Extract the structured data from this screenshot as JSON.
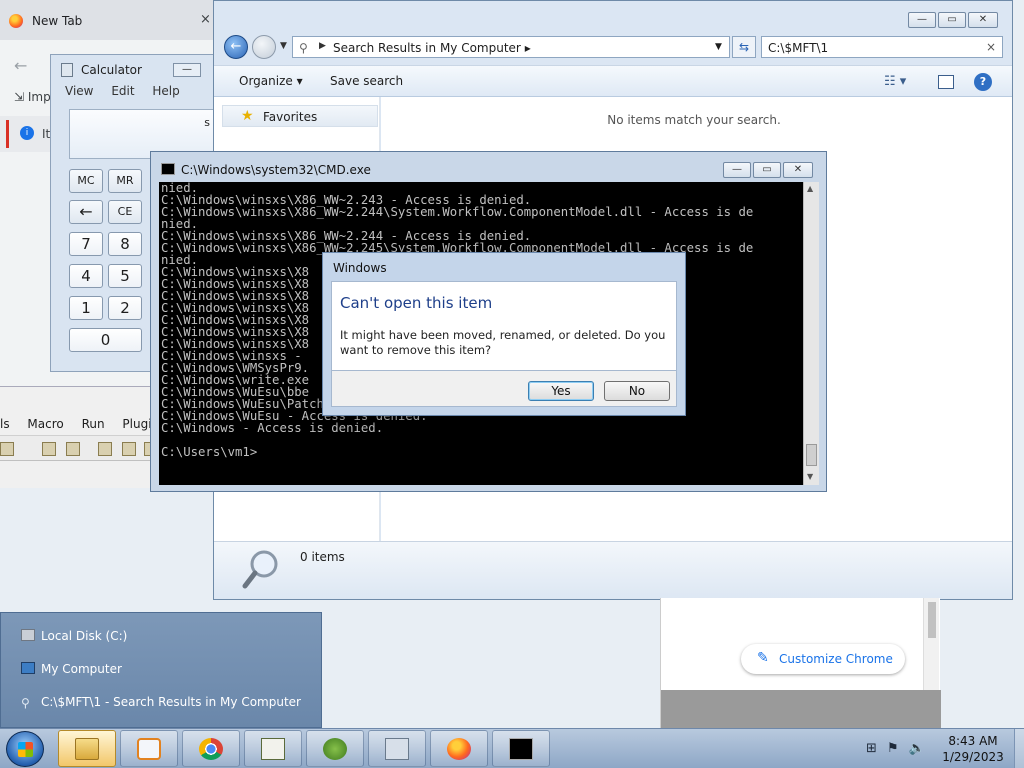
{
  "browser": {
    "tab_title": "New Tab",
    "tab_close": "×",
    "back_glyph": "←",
    "import_label": "Imp",
    "info_label": "It"
  },
  "calculator": {
    "title": "Calculator",
    "minimize_glyph": "—",
    "menu": [
      "View",
      "Edit",
      "Help"
    ],
    "display_text": "s",
    "memory_buttons": [
      "MC",
      "MR"
    ],
    "edit_buttons": [
      "←",
      "CE"
    ],
    "digits_row1": [
      "7",
      "8"
    ],
    "digits_row2": [
      "4",
      "5"
    ],
    "digits_row3": [
      "1",
      "2"
    ],
    "zero": "0"
  },
  "editor": {
    "menu": [
      "ls",
      "Macro",
      "Run",
      "Plugins"
    ]
  },
  "explorer": {
    "address_path": "Search Results in My Computer",
    "search_value": "C:\\$MFT\\1",
    "clear_glyph": "×",
    "commands": {
      "organize": "Organize ▾",
      "save_search": "Save search",
      "views": "☷ ▾",
      "help": "?"
    },
    "nav_favorites": "Favorites",
    "empty_message": "No items match your search.",
    "status_count": "0 items",
    "caption": {
      "minimize": "—",
      "maximize": "▭",
      "close": "✕"
    }
  },
  "cmd": {
    "title": "C:\\Windows\\system32\\CMD.exe",
    "caption": {
      "minimize": "—",
      "maximize": "▭",
      "close": "✕"
    },
    "lines": [
      "nied.",
      "C:\\Windows\\winsxs\\X86_WW~2.243 - Access is denied.",
      "C:\\Windows\\winsxs\\X86_WW~2.244\\System.Workflow.ComponentModel.dll - Access is de",
      "nied.",
      "C:\\Windows\\winsxs\\X86_WW~2.244 - Access is denied.",
      "C:\\Windows\\winsxs\\X86_WW~2.245\\System.Workflow.ComponentModel.dll - Access is de",
      "nied.",
      "C:\\Windows\\winsxs\\X8                                      s is denied.",
      "C:\\Windows\\winsxs\\X8",
      "C:\\Windows\\winsxs\\X8                                      s is denied.",
      "C:\\Windows\\winsxs\\X8",
      "C:\\Windows\\winsxs\\X8                                      s is denied.",
      "C:\\Windows\\winsxs\\X8",
      "C:\\Windows\\winsxs\\X8                                      s is denied.",
      "C:\\Windows\\winsxs - ",
      "C:\\Windows\\WMSysPr9.",
      "C:\\Windows\\write.exe",
      "C:\\Windows\\WuEsu\\bbe",
      "C:\\Windows\\WuEsu\\PatchWU.cmd - Access is denied.",
      "C:\\Windows\\WuEsu - Access is denied.",
      "C:\\Windows - Access is denied.",
      "",
      "C:\\Users\\vm1>"
    ]
  },
  "dialog": {
    "title": "Windows",
    "heading": "Can't open this item",
    "message": "It might have been moved, renamed, or deleted. Do you want to remove this item?",
    "yes": "Yes",
    "no": "No"
  },
  "chrome_pane": {
    "customize": "Customize Chrome",
    "pen_glyph": "✎"
  },
  "jumplist": {
    "items": [
      "Local Disk (C:)",
      "My Computer",
      "C:\\$MFT\\1 - Search Results in My Computer"
    ]
  },
  "taskbar": {
    "time": "8:43 AM",
    "date": "1/29/2023",
    "tray_glyphs": [
      "⊞",
      "⚑",
      "🔈"
    ]
  }
}
